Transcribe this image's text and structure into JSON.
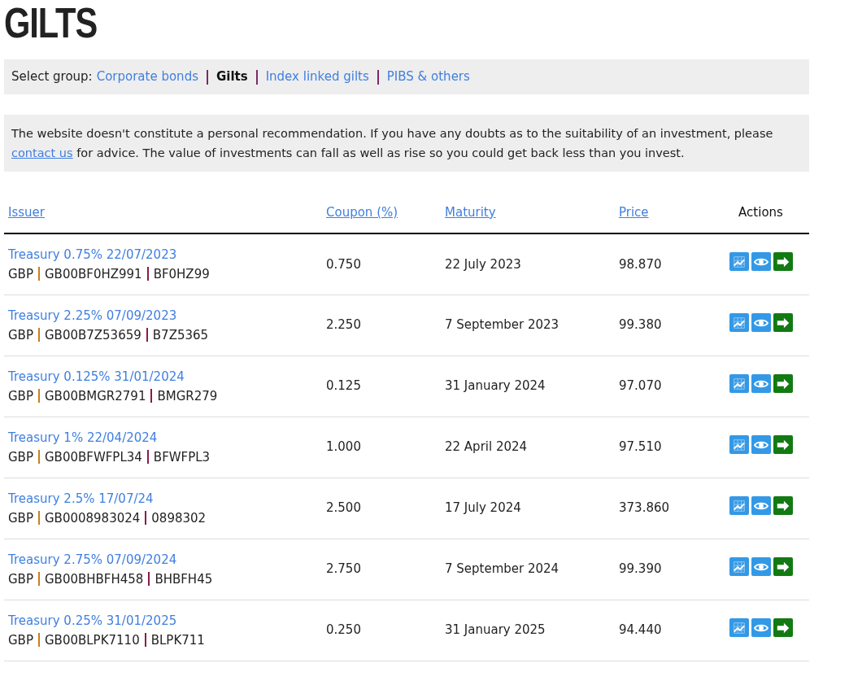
{
  "title": "GILTS",
  "group_selector": {
    "label": "Select group:",
    "groups": [
      {
        "label": "Corporate bonds",
        "selected": false
      },
      {
        "label": "Gilts",
        "selected": true
      },
      {
        "label": "Index linked gilts",
        "selected": false
      },
      {
        "label": "PIBS & others",
        "selected": false
      }
    ]
  },
  "disclaimer": {
    "before": "The website doesn't constitute a personal recommendation. If you have any doubts as to the suitability of an investment, please",
    "link": "contact us",
    "after": "for advice. The value of investments can fall as well as rise so you could get back less than you invest."
  },
  "table": {
    "columns": [
      {
        "label": "Issuer",
        "sortable": true
      },
      {
        "label": "Coupon (%)",
        "sortable": true
      },
      {
        "label": "Maturity",
        "sortable": true
      },
      {
        "label": "Price",
        "sortable": true
      },
      {
        "label": "Actions",
        "sortable": false
      }
    ],
    "rows": [
      {
        "issuer": "Treasury 0.75% 22/07/2023",
        "currency": "GBP",
        "isin": "GB00BF0HZ991",
        "sedol": "BF0HZ99",
        "coupon": "0.750",
        "maturity": "22 July 2023",
        "price": "98.870"
      },
      {
        "issuer": "Treasury 2.25% 07/09/2023",
        "currency": "GBP",
        "isin": "GB00B7Z53659",
        "sedol": "B7Z5365",
        "coupon": "2.250",
        "maturity": "7 September 2023",
        "price": "99.380"
      },
      {
        "issuer": "Treasury 0.125% 31/01/2024",
        "currency": "GBP",
        "isin": "GB00BMGR2791",
        "sedol": "BMGR279",
        "coupon": "0.125",
        "maturity": "31 January 2024",
        "price": "97.070"
      },
      {
        "issuer": "Treasury 1% 22/04/2024",
        "currency": "GBP",
        "isin": "GB00BFWFPL34",
        "sedol": "BFWFPL3",
        "coupon": "1.000",
        "maturity": "22 April 2024",
        "price": "97.510"
      },
      {
        "issuer": "Treasury 2.5% 17/07/24",
        "currency": "GBP",
        "isin": "GB0008983024",
        "sedol": "0898302",
        "coupon": "2.500",
        "maturity": "17 July 2024",
        "price": "373.860"
      },
      {
        "issuer": "Treasury 2.75% 07/09/2024",
        "currency": "GBP",
        "isin": "GB00BHBFH458",
        "sedol": "BHBFH45",
        "coupon": "2.750",
        "maturity": "7 September 2024",
        "price": "99.390"
      },
      {
        "issuer": "Treasury 0.25% 31/01/2025",
        "currency": "GBP",
        "isin": "GB00BLPK7110",
        "sedol": "BLPK711",
        "coupon": "0.250",
        "maturity": "31 January 2025",
        "price": "94.440"
      }
    ]
  }
}
